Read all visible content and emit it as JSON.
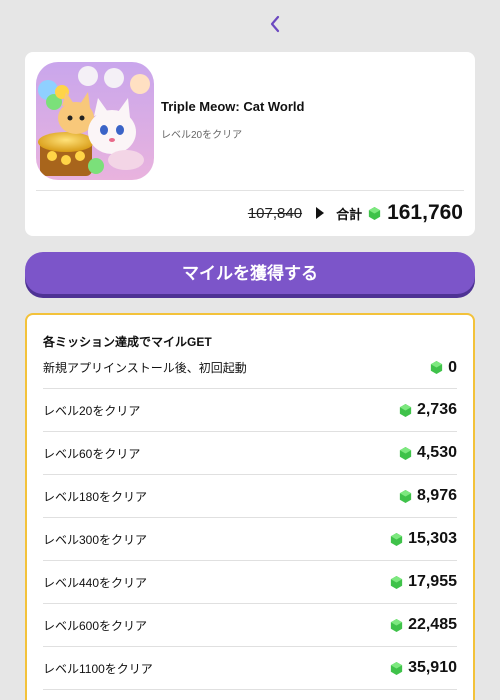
{
  "nav": {
    "back_icon": "chevron-left-icon"
  },
  "app": {
    "title": "Triple Meow: Cat World",
    "subtitle": "レベル20をクリア",
    "old_total": "107,840",
    "total_label": "合計",
    "total_value": "161,760",
    "icon_name": "cat-game-app-icon"
  },
  "earn_button": {
    "label": "マイルを獲得する"
  },
  "missions": {
    "title": "各ミッション達成でマイルGET",
    "rows": [
      {
        "label": "新規アプリインストール後、初回起動",
        "reward": "0"
      },
      {
        "label": "レベル20をクリア",
        "reward": "2,736"
      },
      {
        "label": "レベル60をクリア",
        "reward": "4,530"
      },
      {
        "label": "レベル180をクリア",
        "reward": "8,976"
      },
      {
        "label": "レベル300をクリア",
        "reward": "15,303"
      },
      {
        "label": "レベル440をクリア",
        "reward": "17,955"
      },
      {
        "label": "レベル600をクリア",
        "reward": "22,485"
      },
      {
        "label": "レベル1100をクリア",
        "reward": "35,910"
      }
    ]
  },
  "colors": {
    "accent": "#7c55c9",
    "mission_border": "#f3c23a",
    "gem": "#3fc24a"
  }
}
